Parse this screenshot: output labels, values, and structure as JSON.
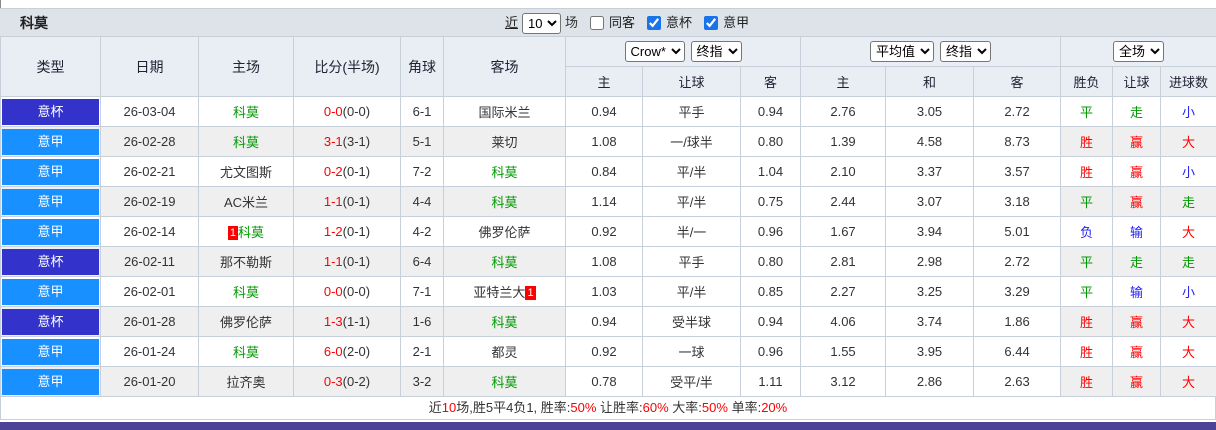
{
  "colors": {
    "cup_bg": "#3333CC",
    "league_bg": "#1890FF",
    "green": "#009900",
    "red": "#FF0000",
    "blue": "#2222EE",
    "dark": "#333333",
    "bottom_bar": "#4C4399"
  },
  "title_bar": {
    "title": "科莫",
    "near_label": "近",
    "matches_value": "10",
    "matches_suffix": "场",
    "checkboxes": [
      {
        "label": "同客",
        "checked": false
      },
      {
        "label": "意杯",
        "checked": true
      },
      {
        "label": "意甲",
        "checked": true
      }
    ]
  },
  "table": {
    "fixed_headers": [
      "类型",
      "日期",
      "主场",
      "比分(半场)",
      "角球",
      "客场"
    ],
    "group_selects": {
      "crow": [
        "Crow*",
        "终指"
      ],
      "average": [
        "平均值",
        "终指"
      ],
      "scope": [
        "全场"
      ]
    },
    "subheaders": [
      "主",
      "让球",
      "客",
      "主",
      "和",
      "客",
      "胜负",
      "让球",
      "进球数"
    ],
    "rows": [
      {
        "type": "意杯",
        "type_color": "cup_bg",
        "date": "26-03-04",
        "home": {
          "name": "科莫",
          "is_como": true
        },
        "score_full": "0-0",
        "score_half": "(0-0)",
        "corners": "6-1",
        "away": {
          "name": "国际米兰",
          "is_como": false
        },
        "crow": [
          "0.94",
          "平手",
          "0.94"
        ],
        "average": [
          "2.76",
          "3.05",
          "2.72"
        ],
        "results": [
          {
            "text": "平",
            "color": "green"
          },
          {
            "text": "走",
            "color": "green"
          },
          {
            "text": "小",
            "color": "blue"
          }
        ]
      },
      {
        "type": "意甲",
        "type_color": "league_bg",
        "date": "26-02-28",
        "home": {
          "name": "科莫",
          "is_como": true
        },
        "score_full": "3-1",
        "score_half": "(3-1)",
        "corners": "5-1",
        "away": {
          "name": "莱切",
          "is_como": false
        },
        "crow": [
          "1.08",
          "一/球半",
          "0.80"
        ],
        "average": [
          "1.39",
          "4.58",
          "8.73"
        ],
        "results": [
          {
            "text": "胜",
            "color": "red"
          },
          {
            "text": "赢",
            "color": "red"
          },
          {
            "text": "大",
            "color": "red"
          }
        ]
      },
      {
        "type": "意甲",
        "type_color": "league_bg",
        "date": "26-02-21",
        "home": {
          "name": "尤文图斯",
          "is_como": false
        },
        "score_full": "0-2",
        "score_half": "(0-1)",
        "corners": "7-2",
        "away": {
          "name": "科莫",
          "is_como": true
        },
        "crow": [
          "0.84",
          "平/半",
          "1.04"
        ],
        "average": [
          "2.10",
          "3.37",
          "3.57"
        ],
        "results": [
          {
            "text": "胜",
            "color": "red"
          },
          {
            "text": "赢",
            "color": "red"
          },
          {
            "text": "小",
            "color": "blue"
          }
        ]
      },
      {
        "type": "意甲",
        "type_color": "league_bg",
        "date": "26-02-19",
        "home": {
          "name": "AC米兰",
          "is_como": false
        },
        "score_full": "1-1",
        "score_half": "(0-1)",
        "corners": "4-4",
        "away": {
          "name": "科莫",
          "is_como": true
        },
        "crow": [
          "1.14",
          "平/半",
          "0.75"
        ],
        "average": [
          "2.44",
          "3.07",
          "3.18"
        ],
        "results": [
          {
            "text": "平",
            "color": "green"
          },
          {
            "text": "赢",
            "color": "red"
          },
          {
            "text": "走",
            "color": "green"
          }
        ]
      },
      {
        "type": "意甲",
        "type_color": "league_bg",
        "date": "26-02-14",
        "home": {
          "name": "科莫",
          "is_como": true,
          "badge": "1",
          "badge_pos": "before"
        },
        "score_full": "1-2",
        "score_half": "(0-1)",
        "corners": "4-2",
        "away": {
          "name": "佛罗伦萨",
          "is_como": false
        },
        "crow": [
          "0.92",
          "半/一",
          "0.96"
        ],
        "average": [
          "1.67",
          "3.94",
          "5.01"
        ],
        "results": [
          {
            "text": "负",
            "color": "blue"
          },
          {
            "text": "输",
            "color": "blue"
          },
          {
            "text": "大",
            "color": "red"
          }
        ]
      },
      {
        "type": "意杯",
        "type_color": "cup_bg",
        "date": "26-02-11",
        "home": {
          "name": "那不勒斯",
          "is_como": false
        },
        "score_full": "1-1",
        "score_half": "(0-1)",
        "corners": "6-4",
        "away": {
          "name": "科莫",
          "is_como": true
        },
        "crow": [
          "1.08",
          "平手",
          "0.80"
        ],
        "average": [
          "2.81",
          "2.98",
          "2.72"
        ],
        "results": [
          {
            "text": "平",
            "color": "green"
          },
          {
            "text": "走",
            "color": "green"
          },
          {
            "text": "走",
            "color": "green"
          }
        ]
      },
      {
        "type": "意甲",
        "type_color": "league_bg",
        "date": "26-02-01",
        "home": {
          "name": "科莫",
          "is_como": true
        },
        "score_full": "0-0",
        "score_half": "(0-0)",
        "corners": "7-1",
        "away": {
          "name": "亚特兰大",
          "is_como": false,
          "badge": "1",
          "badge_pos": "after"
        },
        "crow": [
          "1.03",
          "平/半",
          "0.85"
        ],
        "average": [
          "2.27",
          "3.25",
          "3.29"
        ],
        "results": [
          {
            "text": "平",
            "color": "green"
          },
          {
            "text": "输",
            "color": "blue"
          },
          {
            "text": "小",
            "color": "blue"
          }
        ]
      },
      {
        "type": "意杯",
        "type_color": "cup_bg",
        "date": "26-01-28",
        "home": {
          "name": "佛罗伦萨",
          "is_como": false
        },
        "score_full": "1-3",
        "score_half": "(1-1)",
        "corners": "1-6",
        "away": {
          "name": "科莫",
          "is_como": true
        },
        "crow": [
          "0.94",
          "受半球",
          "0.94"
        ],
        "average": [
          "4.06",
          "3.74",
          "1.86"
        ],
        "results": [
          {
            "text": "胜",
            "color": "red"
          },
          {
            "text": "赢",
            "color": "red"
          },
          {
            "text": "大",
            "color": "red"
          }
        ]
      },
      {
        "type": "意甲",
        "type_color": "league_bg",
        "date": "26-01-24",
        "home": {
          "name": "科莫",
          "is_como": true
        },
        "score_full": "6-0",
        "score_half": "(2-0)",
        "corners": "2-1",
        "away": {
          "name": "都灵",
          "is_como": false
        },
        "crow": [
          "0.92",
          "一球",
          "0.96"
        ],
        "average": [
          "1.55",
          "3.95",
          "6.44"
        ],
        "results": [
          {
            "text": "胜",
            "color": "red"
          },
          {
            "text": "赢",
            "color": "red"
          },
          {
            "text": "大",
            "color": "red"
          }
        ]
      },
      {
        "type": "意甲",
        "type_color": "league_bg",
        "date": "26-01-20",
        "home": {
          "name": "拉齐奥",
          "is_como": false
        },
        "score_full": "0-3",
        "score_half": "(0-2)",
        "corners": "3-2",
        "away": {
          "name": "科莫",
          "is_como": true
        },
        "crow": [
          "0.78",
          "受平/半",
          "1.11"
        ],
        "average": [
          "3.12",
          "2.86",
          "2.63"
        ],
        "results": [
          {
            "text": "胜",
            "color": "red"
          },
          {
            "text": "赢",
            "color": "red"
          },
          {
            "text": "大",
            "color": "red"
          }
        ]
      }
    ]
  },
  "footer": {
    "segments": [
      {
        "text": "近",
        "color": "dark"
      },
      {
        "text": "10",
        "color": "red"
      },
      {
        "text": "场,胜5平4负1, 胜率:",
        "color": "dark"
      },
      {
        "text": "50%",
        "color": "red"
      },
      {
        "text": " 让胜率:",
        "color": "dark"
      },
      {
        "text": "60%",
        "color": "red"
      },
      {
        "text": " 大率:",
        "color": "dark"
      },
      {
        "text": "50%",
        "color": "red"
      },
      {
        "text": " 单率:",
        "color": "dark"
      },
      {
        "text": "20%",
        "color": "red"
      }
    ]
  }
}
